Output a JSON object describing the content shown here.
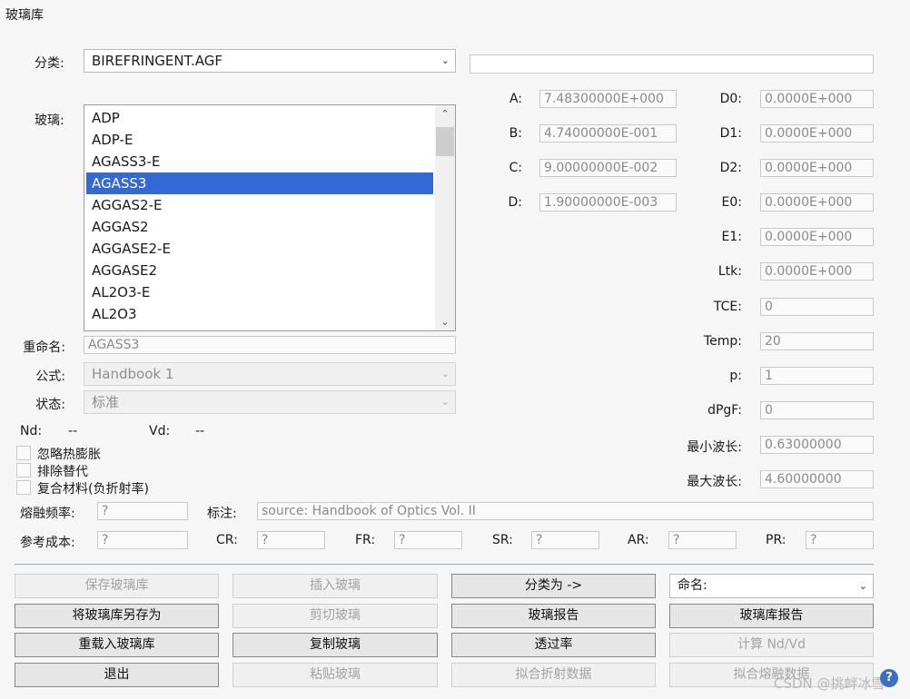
{
  "window_title": "玻璃库",
  "category": {
    "label": "分类:",
    "value": "BIREFRINGENT.AGF"
  },
  "description_field": "",
  "glass": {
    "label": "玻璃:",
    "items": [
      "ADP",
      "ADP-E",
      "AGASS3-E",
      "AGASS3",
      "AGGAS2-E",
      "AGGAS2",
      "AGGASE2-E",
      "AGGASE2",
      "AL2O3-E",
      "AL2O3"
    ],
    "selected_index": 3
  },
  "coeffs": [
    {
      "label": "A:",
      "value": "7.48300000E+000"
    },
    {
      "label": "B:",
      "value": "4.74000000E-001"
    },
    {
      "label": "C:",
      "value": "9.00000000E-002"
    },
    {
      "label": "D:",
      "value": "1.90000000E-003"
    }
  ],
  "thermal": [
    {
      "label": "D0:",
      "value": "0.0000E+000"
    },
    {
      "label": "D1:",
      "value": "0.0000E+000"
    },
    {
      "label": "D2:",
      "value": "0.0000E+000"
    },
    {
      "label": "E0:",
      "value": "0.0000E+000"
    },
    {
      "label": "E1:",
      "value": "0.0000E+000"
    },
    {
      "label": "Ltk:",
      "value": "0.0000E+000"
    },
    {
      "label": "TCE:",
      "value": "0"
    },
    {
      "label": "Temp:",
      "value": "20"
    },
    {
      "label": "p:",
      "value": "1"
    },
    {
      "label": "dPgF:",
      "value": "0"
    },
    {
      "label": "最小波长:",
      "value": "0.63000000"
    },
    {
      "label": "最大波长:",
      "value": "4.60000000"
    }
  ],
  "rename": {
    "label": "重命名:",
    "value": "AGASS3"
  },
  "formula": {
    "label": "公式:",
    "value": "Handbook 1"
  },
  "status": {
    "label": "状态:",
    "value": "标准"
  },
  "nd": {
    "label": "Nd:",
    "value": "--"
  },
  "vd": {
    "label": "Vd:",
    "value": "--"
  },
  "checkboxes": [
    "忽略热膨胀",
    "排除替代",
    "复合材料(负折射率)"
  ],
  "melt_freq": {
    "label": "熔融频率:",
    "value": "?"
  },
  "note": {
    "label": "标注:",
    "value": "source:  Handbook of Optics Vol. II"
  },
  "cost_row": [
    {
      "label": "参考成本:",
      "value": "?"
    },
    {
      "label": "CR:",
      "value": "?"
    },
    {
      "label": "FR:",
      "value": "?"
    },
    {
      "label": "SR:",
      "value": "?"
    },
    {
      "label": "AR:",
      "value": "?"
    },
    {
      "label": "PR:",
      "value": "?"
    }
  ],
  "buttons": {
    "save_catalog": "保存玻璃库",
    "insert_glass": "插入玻璃",
    "category_to": "分类为 ->",
    "save_catalog_as": "将玻璃库另存为",
    "cut_glass": "剪切玻璃",
    "glass_report": "玻璃报告",
    "catalog_report": "玻璃库报告",
    "reload_catalog": "重载入玻璃库",
    "copy_glass": "复制玻璃",
    "transmission": "透过率",
    "calc_nd_vd": "计算 Nd/Vd",
    "exit": "退出",
    "paste_glass": "粘贴玻璃",
    "fit_index": "拟合折射数据",
    "fit_melt": "拟合熔融数据"
  },
  "name_combo": "命名:",
  "watermark": "CSDN @挑衅冰雪",
  "help_label": "?"
}
